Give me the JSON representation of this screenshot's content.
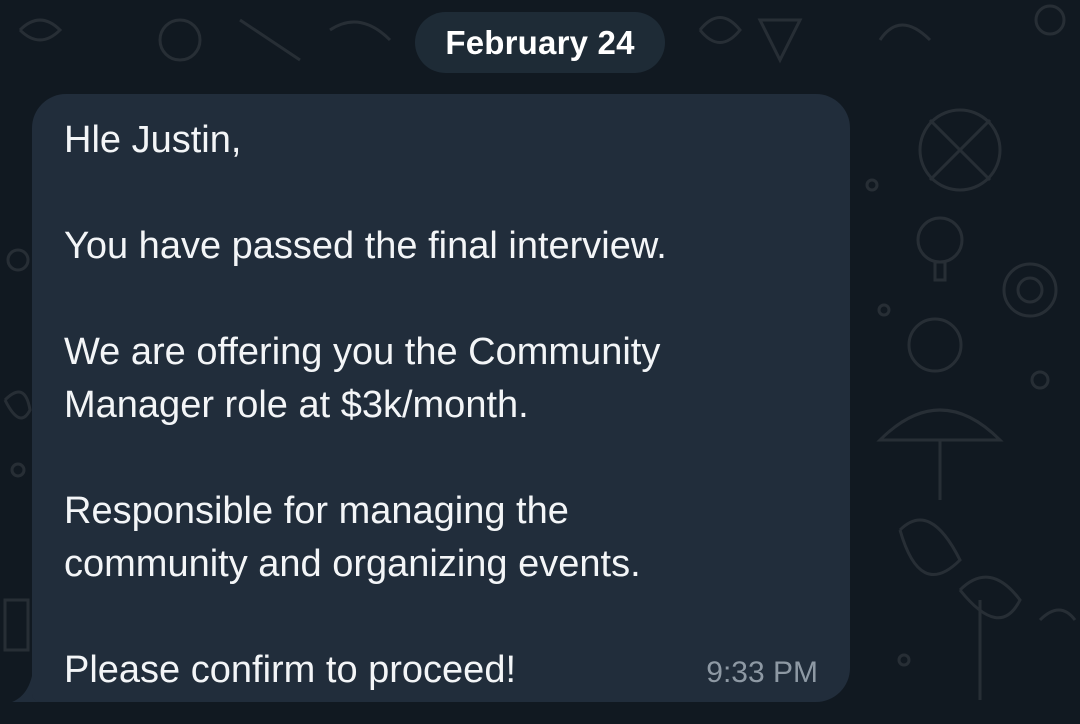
{
  "chat": {
    "date_label": "February 24",
    "message": {
      "text": "Hle Justin,\n\nYou have passed the final interview.\n\nWe are offering you the Community\nManager role at $3k/month.\n\nResponsible for managing the\ncommunity and organizing events.\n\nPlease confirm to proceed!",
      "time": "9:33 PM"
    }
  },
  "colors": {
    "background": "#111921",
    "bubble": "#212d3b",
    "date_pill": "#1e2b36",
    "text": "#f3f5f7",
    "timestamp": "#8e99a4"
  },
  "icons": [
    "chat-doodle-background-pattern"
  ]
}
